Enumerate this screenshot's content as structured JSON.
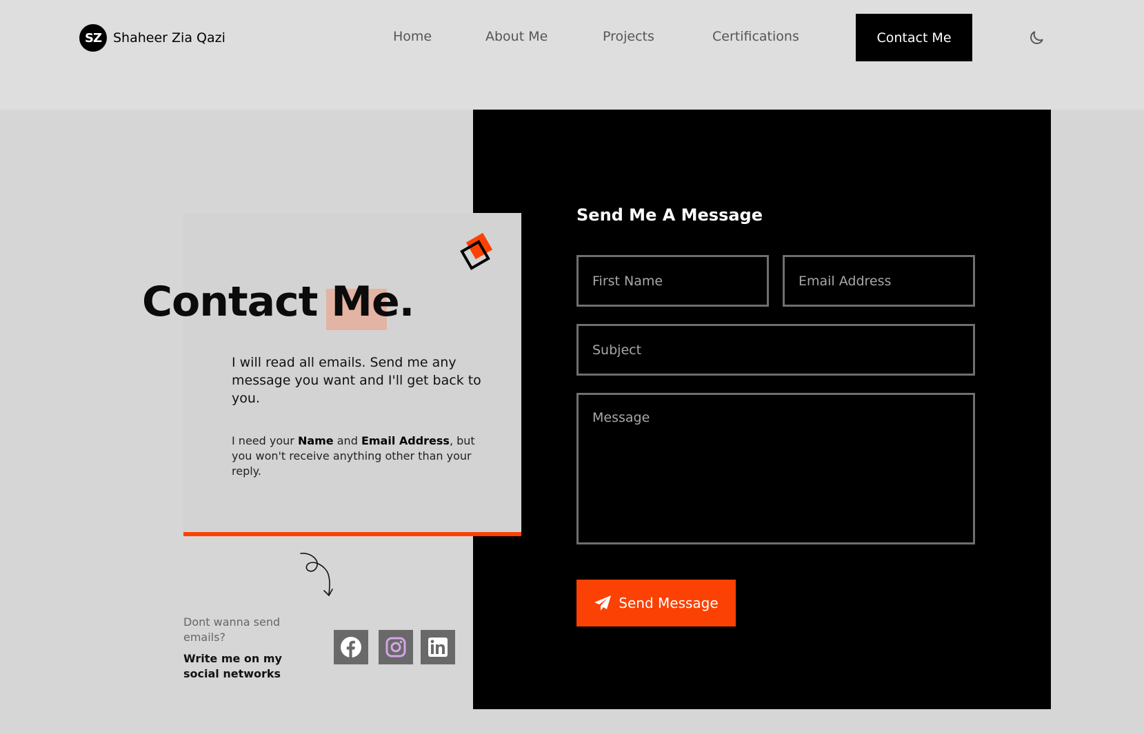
{
  "brand": {
    "initials": "SZ",
    "name": "Shaheer Zia Qazi"
  },
  "nav": {
    "items": [
      {
        "label": "Home"
      },
      {
        "label": "About Me"
      },
      {
        "label": "Projects"
      },
      {
        "label": "Certifications"
      }
    ],
    "active_label": "Contact Me",
    "theme_icon": "moon-icon"
  },
  "intro": {
    "title": "Contact Me.",
    "lead": "I will read all emails. Send me any message you want and I'll get back to you.",
    "note_prefix": "I need your ",
    "note_name": "Name",
    "note_and": " and ",
    "note_email": "Email Address",
    "note_suffix": ", but you won't receive anything other than your reply."
  },
  "social": {
    "question": "Dont wanna send emails?",
    "cta": "Write me on my social networks",
    "icons": [
      "facebook-icon",
      "instagram-icon",
      "linkedin-icon"
    ]
  },
  "form": {
    "title": "Send Me A Message",
    "first_name_placeholder": "First Name",
    "email_placeholder": "Email Address",
    "subject_placeholder": "Subject",
    "message_placeholder": "Message",
    "submit_label": "Send Message"
  },
  "colors": {
    "accent": "#fb4103",
    "panel": "#000000",
    "header_bg": "#dedede",
    "page_bg": "#d6d6d6",
    "title_highlight": "#e3b3a3",
    "instagram_tint": "#d3a6e6"
  }
}
